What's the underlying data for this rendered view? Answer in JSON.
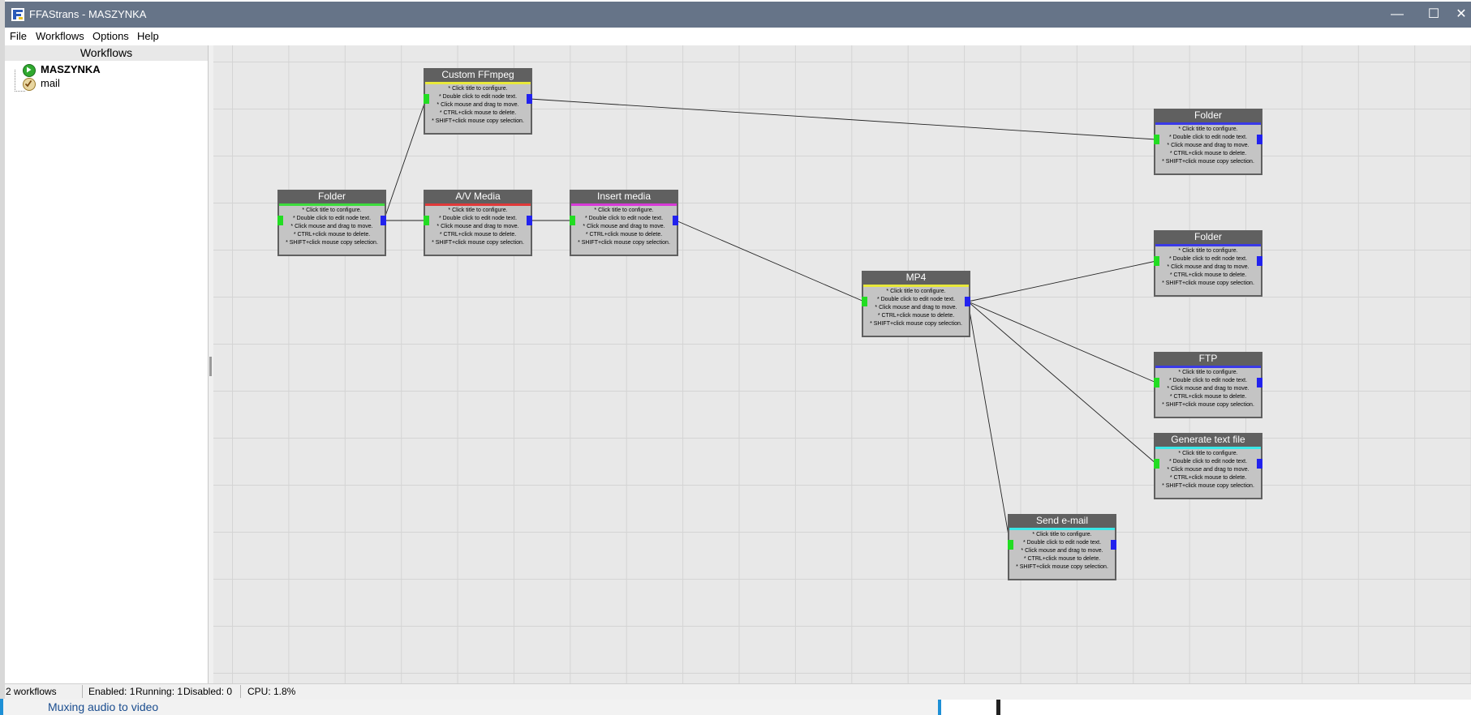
{
  "window": {
    "title": "FFAStrans - MASZYNKA",
    "controls": {
      "minimize": "—",
      "maximize": "☐",
      "close": "✕"
    },
    "titlebar_color": "#667488"
  },
  "menu": [
    "File",
    "Workflows",
    "Options",
    "Help"
  ],
  "sidebar": {
    "header": "Workflows",
    "items": [
      {
        "label": "MASZYNKA",
        "icon": "play-icon",
        "active": true
      },
      {
        "label": "mail",
        "icon": "check-icon",
        "active": false
      }
    ]
  },
  "node_help": [
    "* Click title to configure.",
    "* Double click to edit node text.",
    "* Click mouse and drag to move.",
    "* CTRL+click mouse to delete.",
    "* SHIFT+click mouse copy selection."
  ],
  "nodes": [
    {
      "id": "folder-1",
      "title": "Folder",
      "stripe": "#3ddc3d"
    },
    {
      "id": "custom-ffmpeg",
      "title": "Custom FFmpeg",
      "stripe": "#e8e83a"
    },
    {
      "id": "av-media",
      "title": "A/V Media",
      "stripe": "#e03a3a"
    },
    {
      "id": "insert-media",
      "title": "Insert media",
      "stripe": "#d83ad8"
    },
    {
      "id": "mp4",
      "title": "MP4",
      "stripe": "#e8e83a"
    },
    {
      "id": "folder-2",
      "title": "Folder",
      "stripe": "#3a3ae8"
    },
    {
      "id": "folder-3",
      "title": "Folder",
      "stripe": "#3a3ae8"
    },
    {
      "id": "ftp",
      "title": "FTP",
      "stripe": "#3a3ae8"
    },
    {
      "id": "generate-text-file",
      "title": "Generate text file",
      "stripe": "#3ae8e8"
    },
    {
      "id": "send-email",
      "title": "Send e-mail",
      "stripe": "#3ae8e8"
    }
  ],
  "links": [
    [
      "folder-1",
      "custom-ffmpeg"
    ],
    [
      "folder-1",
      "av-media"
    ],
    [
      "av-media",
      "insert-media"
    ],
    [
      "insert-media",
      "mp4"
    ],
    [
      "custom-ffmpeg",
      "folder-2"
    ],
    [
      "mp4",
      "folder-3"
    ],
    [
      "mp4",
      "ftp"
    ],
    [
      "mp4",
      "generate-text-file"
    ],
    [
      "mp4",
      "send-email"
    ]
  ],
  "status": {
    "workflows": "2 workflows",
    "enabled": "Enabled: 1",
    "running": "Running: 1",
    "disabled": "Disabled: 0",
    "cpu": "CPU: 1.8%"
  },
  "background_window": {
    "text": "Muxing audio to video"
  }
}
